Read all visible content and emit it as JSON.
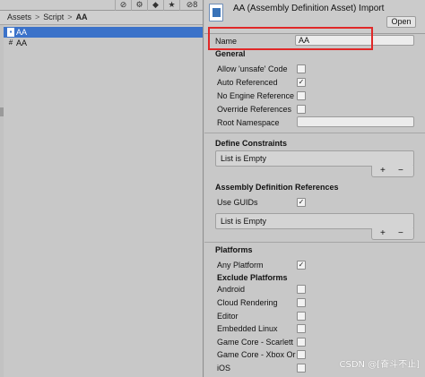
{
  "project": {
    "toolbar_icons": [
      "eye-hidden-icon",
      "package-icon",
      "tag-icon",
      "star-icon",
      "visibility-count-icon"
    ],
    "toolbar_count": "8",
    "breadcrumb": [
      "Assets",
      "Script",
      "AA"
    ],
    "assets": [
      {
        "name": "AA",
        "icon": "assembly-definition-icon",
        "selected": true
      },
      {
        "name": "AA",
        "icon": "csharp-script-icon",
        "selected": false
      }
    ]
  },
  "inspector": {
    "title": "AA (Assembly Definition Asset) Import",
    "open_label": "Open",
    "name_label": "Name",
    "name_value": "AA",
    "general": {
      "title": "General",
      "allow_unsafe": {
        "label": "Allow 'unsafe' Code",
        "checked": false
      },
      "auto_referenced": {
        "label": "Auto Referenced",
        "checked": true
      },
      "no_engine_references": {
        "label": "No Engine Reference",
        "checked": false
      },
      "override_references": {
        "label": "Override References",
        "checked": false
      },
      "root_namespace": {
        "label": "Root Namespace",
        "value": ""
      }
    },
    "define_constraints": {
      "title": "Define Constraints",
      "empty_text": "List is Empty",
      "add": "+",
      "remove": "−"
    },
    "assembly_refs": {
      "title": "Assembly Definition References",
      "use_guids": {
        "label": "Use GUIDs",
        "checked": true
      },
      "empty_text": "List is Empty",
      "add": "+",
      "remove": "−"
    },
    "platforms": {
      "title": "Platforms",
      "any_platform": {
        "label": "Any Platform",
        "checked": true
      },
      "exclude_title": "Exclude Platforms",
      "items": [
        {
          "label": "Android",
          "checked": false
        },
        {
          "label": "Cloud Rendering",
          "checked": false
        },
        {
          "label": "Editor",
          "checked": false
        },
        {
          "label": "Embedded Linux",
          "checked": false
        },
        {
          "label": "Game Core - Scarlett",
          "checked": false
        },
        {
          "label": "Game Core - Xbox Or",
          "checked": false
        },
        {
          "label": "iOS",
          "checked": false
        }
      ]
    }
  },
  "watermark": "CSDN @[奋斗不止]",
  "check_mark": "✓"
}
